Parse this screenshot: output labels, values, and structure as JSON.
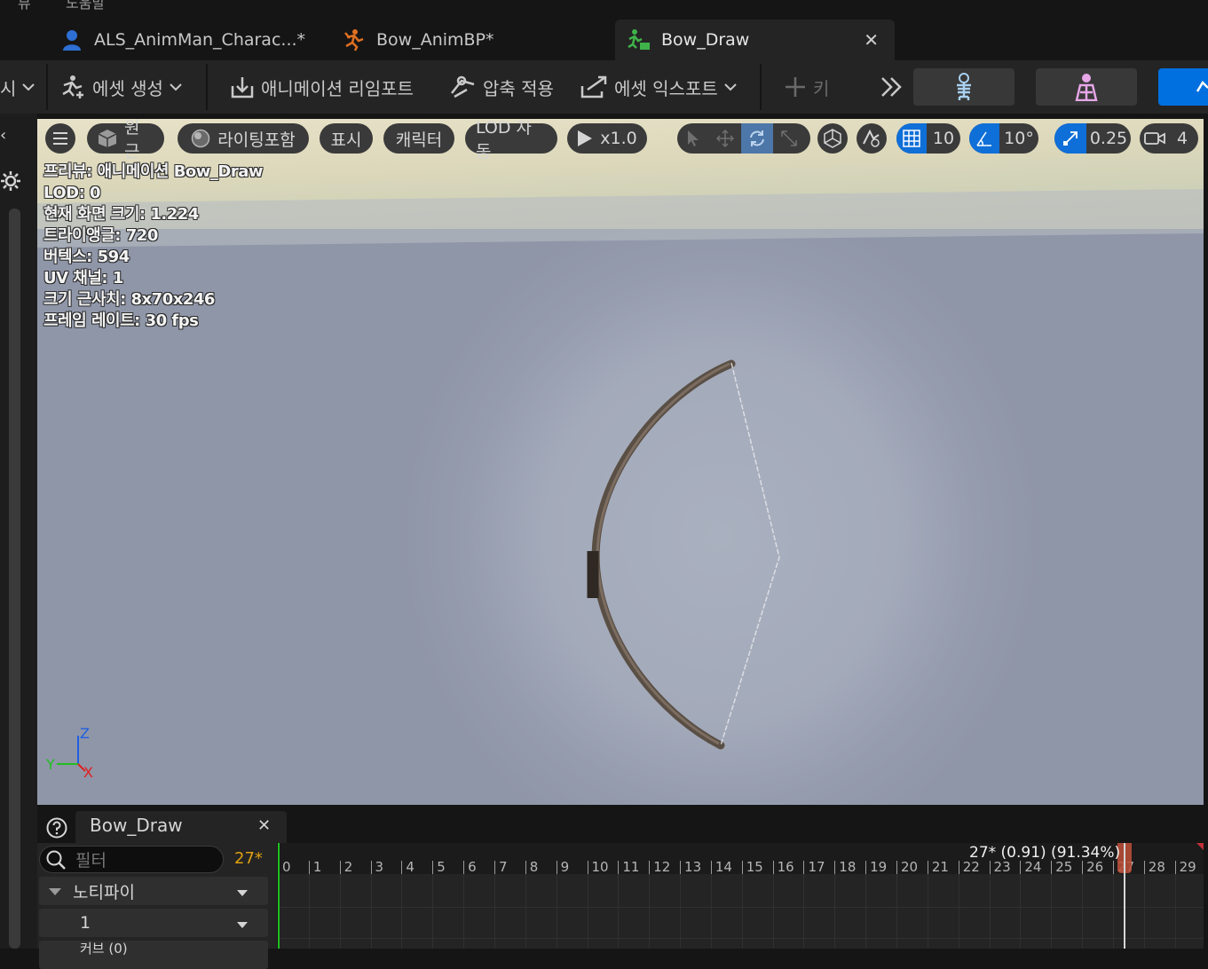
{
  "menubar": {
    "items": [
      "뷰",
      "도움말"
    ]
  },
  "tabs": [
    {
      "label": "ALS_AnimMan_Charac...*",
      "icon": "character-icon",
      "active": false
    },
    {
      "label": "Bow_AnimBP*",
      "icon": "anim-blueprint-icon",
      "active": false
    },
    {
      "label": "Bow_Draw",
      "icon": "animation-sequence-icon",
      "active": true
    }
  ],
  "toolbar": {
    "cut_label": "시",
    "create_asset": "에셋 생성",
    "reimport": "애니메이션 리임포트",
    "apply_compression": "압축 적용",
    "export_asset": "에셋 익스포트",
    "add_key": "키"
  },
  "viewport": {
    "perspective": "원근",
    "lighting": "라이팅포함",
    "show": "표시",
    "character": "캐릭터",
    "lod": "LOD 자동",
    "play_speed": "x1.0",
    "grid_snap": "10",
    "rotation_snap": "10°",
    "scale_snap": "0.25",
    "camera_speed": "4",
    "stats": [
      "프리뷰: 애니메이션 Bow_Draw",
      "LOD: 0",
      "현재 화면 크기: 1.224",
      "트라이앵글: 720",
      "버텍스: 594",
      "UV 채널: 1",
      "크기 근사치: 8x70x246",
      "프레임 레이트: 30 fps"
    ],
    "axis": {
      "z": "Z",
      "y": "Y",
      "x": "X"
    }
  },
  "bottom_panel": {
    "tab_label": "Bow_Draw",
    "filter_placeholder": "필터",
    "current_frame": "27*",
    "notify_track": "노티파이",
    "track_1": "1",
    "track_cut": "커브 (0)",
    "timeline_ticks": [
      "0",
      "1",
      "2",
      "3",
      "4",
      "5",
      "6",
      "7",
      "8",
      "9",
      "10",
      "11",
      "12",
      "13",
      "14",
      "15",
      "16",
      "17",
      "18",
      "19",
      "20",
      "21",
      "22",
      "23",
      "24",
      "25",
      "26",
      "27",
      "28",
      "29"
    ],
    "playhead_readout": "27* (0.91) (91.34%)"
  },
  "colors": {
    "accent_blue": "#0070e0",
    "frame_orange": "#e0a010",
    "playhead_red": "#c0503a",
    "axis_x": "#e02020",
    "axis_y": "#20c020",
    "axis_z": "#2060e0"
  }
}
